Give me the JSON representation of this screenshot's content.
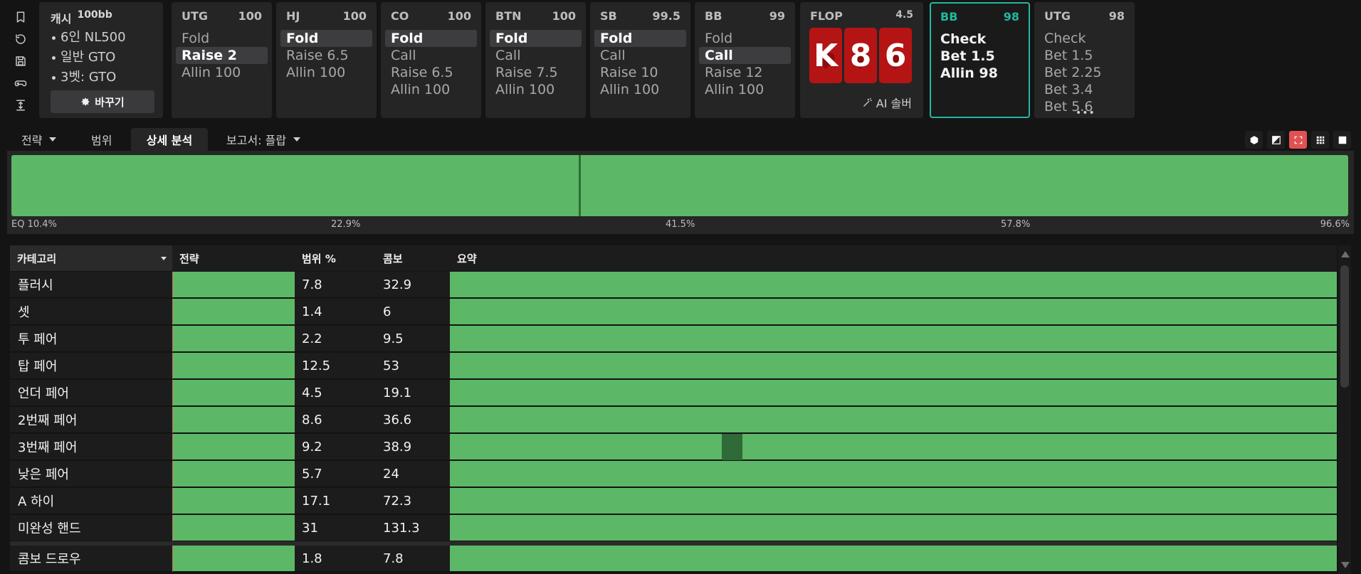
{
  "sidebar_icons": [
    "bookmark-icon",
    "history-icon",
    "save-icon",
    "gamepad-icon",
    "collapse-icon"
  ],
  "config": {
    "game": "캐시",
    "stack": "100bb",
    "options": [
      "6인 NL500",
      "일반 GTO",
      "3벳: GTO"
    ],
    "change_label": "바꾸기"
  },
  "positions": [
    {
      "name": "UTG",
      "stack": "100",
      "actions": [
        "Fold",
        "Raise 2",
        "Allin 100"
      ],
      "selected": 1
    },
    {
      "name": "HJ",
      "stack": "100",
      "actions": [
        "Fold",
        "Raise 6.5",
        "Allin 100"
      ],
      "selected": 0
    },
    {
      "name": "CO",
      "stack": "100",
      "actions": [
        "Fold",
        "Call",
        "Raise 6.5",
        "Allin 100"
      ],
      "selected": 0
    },
    {
      "name": "BTN",
      "stack": "100",
      "actions": [
        "Fold",
        "Call",
        "Raise 7.5",
        "Allin 100"
      ],
      "selected": 0
    },
    {
      "name": "SB",
      "stack": "99.5",
      "actions": [
        "Fold",
        "Call",
        "Raise 10",
        "Allin 100"
      ],
      "selected": 0
    },
    {
      "name": "BB",
      "stack": "99",
      "actions": [
        "Fold",
        "Call",
        "Raise 12",
        "Allin 100"
      ],
      "selected": 1
    }
  ],
  "flop": {
    "label": "FLOP",
    "pot": "4.5",
    "cards": [
      "K",
      "8",
      "6"
    ],
    "suit_color": "#b51414",
    "ai_solver_label": "AI 솔버"
  },
  "current": {
    "name": "BB",
    "stack": "98",
    "actions": [
      "Check",
      "Bet 1.5",
      "Allin 98"
    ],
    "accent": "#22b8a0"
  },
  "next": {
    "name": "UTG",
    "stack": "98",
    "actions": [
      "Check",
      "Bet 1.5",
      "Bet 2.25",
      "Bet 3.4",
      "Bet 5.6"
    ],
    "more": "•••"
  },
  "tabs": [
    {
      "label": "전략",
      "dropdown": true
    },
    {
      "label": "범위",
      "dropdown": false
    },
    {
      "label": "상세 분석",
      "dropdown": false,
      "active": true
    },
    {
      "label": "보고서: 플랍",
      "dropdown": true
    }
  ],
  "view_buttons": [
    "cube-icon",
    "contrast-icon",
    "expand-icon",
    "grid-icon",
    "square-icon"
  ],
  "equity": {
    "labels": [
      "EQ 10.4%",
      "22.9%",
      "41.5%",
      "57.8%",
      "96.6%"
    ],
    "bar_color": "#5cb866",
    "divider_fraction": 0.426
  },
  "table": {
    "headers": {
      "category": "카테고리",
      "strategy": "전략",
      "range": "범위 %",
      "combo": "콤보",
      "summary": "요약"
    },
    "rows": [
      {
        "category": "플러시",
        "range": "7.8",
        "combo": "32.9"
      },
      {
        "category": "셋",
        "range": "1.4",
        "combo": "6"
      },
      {
        "category": "투 페어",
        "range": "2.2",
        "combo": "9.5"
      },
      {
        "category": "탑 페어",
        "range": "12.5",
        "combo": "53"
      },
      {
        "category": "언더 페어",
        "range": "4.5",
        "combo": "19.1"
      },
      {
        "category": "2번째 페어",
        "range": "8.6",
        "combo": "36.6"
      },
      {
        "category": "3번째 페어",
        "range": "9.2",
        "combo": "38.9"
      },
      {
        "category": "낮은 페어",
        "range": "5.7",
        "combo": "24"
      },
      {
        "category": "A 하이",
        "range": "17.1",
        "combo": "72.3"
      },
      {
        "category": "미완성 핸드",
        "range": "31",
        "combo": "131.3"
      }
    ],
    "extra_rows": [
      {
        "category": "콤보 드로우",
        "range": "1.8",
        "combo": "7.8"
      }
    ]
  }
}
